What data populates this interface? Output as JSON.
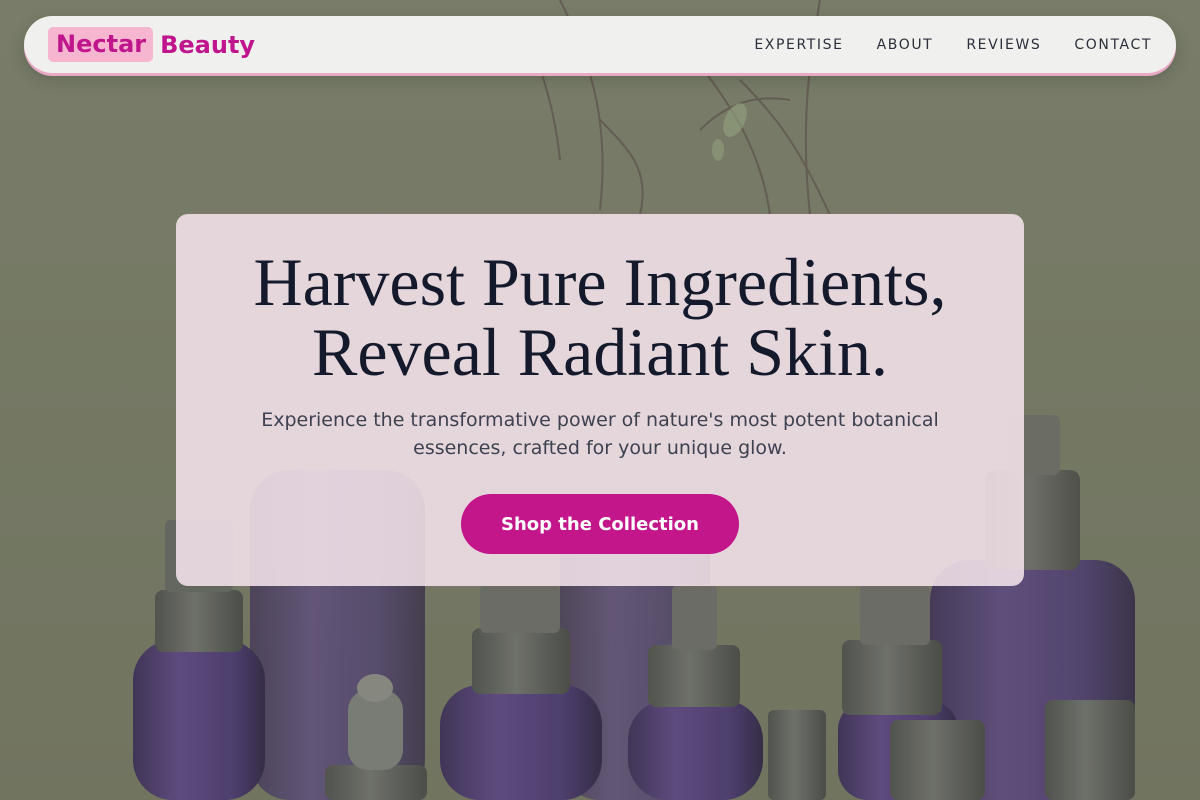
{
  "brand": {
    "name_part1": "Nectar",
    "name_part2": "Beauty",
    "accent": "#c0168d",
    "highlight": "#f7b6cf"
  },
  "nav": {
    "links": [
      "EXPERTISE",
      "ABOUT",
      "REVIEWS",
      "CONTACT"
    ]
  },
  "hero": {
    "title_line1": "Harvest Pure Ingredients,",
    "title_line2": "Reveal Radiant Skin.",
    "subtitle_line1": "Experience the transformative power of nature's most potent botanical",
    "subtitle_line2": "essences, crafted for your unique glow.",
    "cta_label": "Shop the Collection",
    "cta_color": "#c2168a"
  }
}
